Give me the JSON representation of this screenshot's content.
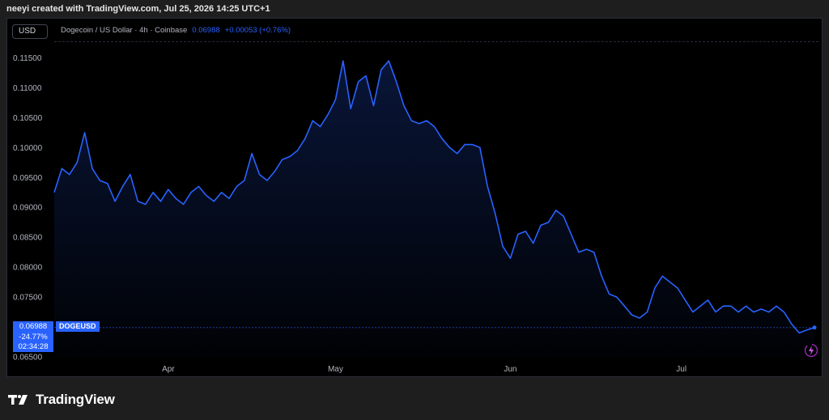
{
  "caption": "neeyi created with TradingView.com, Jul 25, 2026 14:25 UTC+1",
  "toolbar": {
    "currency_label": "USD"
  },
  "legend": {
    "symbol_desc": "Dogecoin / US Dollar · 4h · Coinbase",
    "last_price": "0.06988",
    "change": "+0.00053 (+0.76%)"
  },
  "price_tag": {
    "price": "0.06988",
    "change_pct": "-24.77%",
    "countdown": "02:34:28",
    "symbol": "DOGEUSD"
  },
  "brand": {
    "name": "TradingView"
  },
  "colors": {
    "line": "#2962ff",
    "accent": "#2962ff",
    "background": "#000000"
  },
  "icons": {
    "flash": "flash-circle-icon",
    "logo": "tradingview-logo-icon"
  },
  "chart_data": {
    "type": "area",
    "ylim": [
      0.065,
      0.1175
    ],
    "xlim": [
      0,
      100
    ],
    "y_ticks": [
      "0.11500",
      "0.11000",
      "0.10500",
      "0.10000",
      "0.09500",
      "0.09000",
      "0.08500",
      "0.08000",
      "0.07500",
      "0.06500"
    ],
    "y_tick_values": [
      0.115,
      0.11,
      0.105,
      0.1,
      0.095,
      0.09,
      0.085,
      0.08,
      0.075,
      0.065
    ],
    "x_ticks": [
      "Apr",
      "May",
      "Jun",
      "Jul"
    ],
    "x_tick_positions": [
      15,
      37,
      60,
      82.5
    ],
    "grid": false,
    "series": [
      {
        "x": [
          0,
          1,
          2,
          3,
          4,
          5,
          6,
          7,
          8,
          9,
          10,
          11,
          12,
          13,
          14,
          15,
          16,
          17,
          18,
          19,
          20,
          21,
          22,
          23,
          24,
          25,
          26,
          27,
          28,
          29,
          30,
          31,
          32,
          33,
          34,
          35,
          36,
          37,
          38,
          39,
          40,
          41,
          42,
          43,
          44,
          45,
          46,
          47,
          48,
          49,
          50,
          51,
          52,
          53,
          54,
          55,
          56,
          57,
          58,
          59,
          60,
          61,
          62,
          63,
          64,
          65,
          66,
          67,
          68,
          69,
          70,
          71,
          72,
          73,
          74,
          75,
          76,
          77,
          78,
          79,
          80,
          81,
          82,
          83,
          84,
          85,
          86,
          87,
          88,
          89,
          90,
          91,
          92,
          93,
          94,
          95,
          96,
          97,
          98,
          99,
          100
        ],
        "y": [
          0.0925,
          0.0965,
          0.0955,
          0.0975,
          0.1025,
          0.0965,
          0.0945,
          0.094,
          0.091,
          0.0935,
          0.0955,
          0.091,
          0.0905,
          0.0925,
          0.091,
          0.093,
          0.0915,
          0.0905,
          0.0925,
          0.0935,
          0.092,
          0.091,
          0.0925,
          0.0915,
          0.0935,
          0.0945,
          0.099,
          0.0955,
          0.0945,
          0.096,
          0.098,
          0.0985,
          0.0995,
          0.1015,
          0.1045,
          0.1035,
          0.1055,
          0.108,
          0.1145,
          0.1065,
          0.111,
          0.112,
          0.107,
          0.113,
          0.1145,
          0.111,
          0.107,
          0.1045,
          0.104,
          0.1045,
          0.1035,
          0.1015,
          0.1,
          0.099,
          0.1005,
          0.1005,
          0.1,
          0.0935,
          0.089,
          0.0835,
          0.0815,
          0.0855,
          0.086,
          0.084,
          0.087,
          0.0875,
          0.0895,
          0.0885,
          0.0855,
          0.0825,
          0.083,
          0.0825,
          0.0785,
          0.0755,
          0.075,
          0.0735,
          0.072,
          0.0715,
          0.0725,
          0.0765,
          0.0785,
          0.0775,
          0.0765,
          0.0745,
          0.0725,
          0.0735,
          0.0745,
          0.0725,
          0.0735,
          0.0735,
          0.0725,
          0.0735,
          0.0725,
          0.073,
          0.0725,
          0.0735,
          0.0725,
          0.0705,
          0.069,
          0.0695,
          0.0699
        ]
      }
    ]
  }
}
